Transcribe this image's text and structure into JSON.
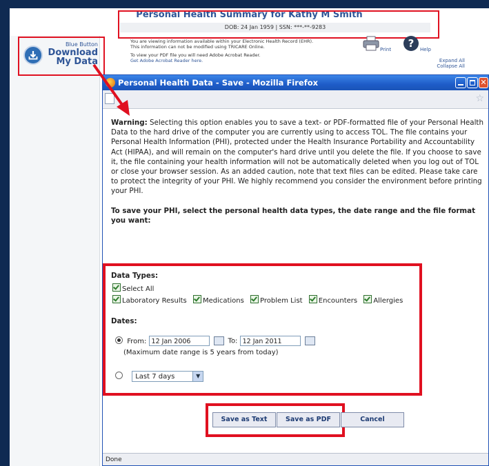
{
  "header": {
    "title": "Personal Health Summary for Kathy M Smith",
    "subtitle": "DOB: 24 Jan 1959 | SSN: ***-**-9283",
    "info_line1": "You are viewing information available within your Electronic Health Record (EHR).",
    "info_line2": "This information can not be modified using TRICARE Online.",
    "info_line3": "To view your PDF file you will need Adobe Acrobat Reader.",
    "info_line4": "Get Adobe Acrobat Reader here.",
    "print_label": "Print",
    "help_label": "Help",
    "expand_all": "Expand All",
    "collapse_all": "Collapse All"
  },
  "blue_button": {
    "small": "Blue Button",
    "line1": "Download",
    "line2": "My Data"
  },
  "window": {
    "title": "Personal Health Data - Save - Mozilla Firefox",
    "status": "Done"
  },
  "content": {
    "warning_label": "Warning:",
    "warning_text": " Selecting this option enables you to save a text- or PDF-formatted file of your Personal Health Data to the hard drive of the computer you are currently using to access TOL. The file contains your Personal Health Information (PHI), protected under the Health Insurance Portability and Accountability Act (HIPAA), and will remain on the computer's hard drive until you delete the file. If you choose to save it, the file containing your health information will not be automatically deleted when you log out of TOL or close your browser session. As an added caution, note that text files can be edited. Please take care to protect the integrity of your PHI. We highly recommend you consider the environment before printing your PHI.",
    "instruction": "To save your PHI, select the personal health data types, the date range and the file format you want:",
    "data_types_label": "Data Types:",
    "select_all": "Select All",
    "types": [
      "Laboratory Results",
      "Medications",
      "Problem List",
      "Encounters",
      "Allergies"
    ],
    "dates_label": "Dates:",
    "from_label": "From:",
    "from_value": "12 Jan 2006",
    "to_label": "To:",
    "to_value": "12 Jan 2011",
    "range_note": "(Maximum date range is 5 years from today)",
    "preset_value": "Last 7 days",
    "save_text": "Save as Text",
    "save_pdf": "Save as PDF",
    "cancel": "Cancel"
  }
}
